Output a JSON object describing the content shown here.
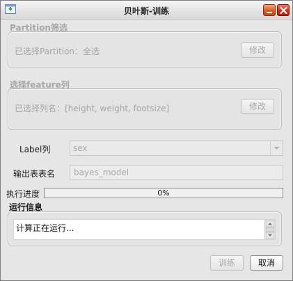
{
  "window": {
    "title": "贝叶斯-训练",
    "app_icon": "window-app-icon",
    "minimize_icon": "minimize-icon",
    "close_icon": "close-icon"
  },
  "partition": {
    "section_title": "Partition筛选",
    "summary": "已选择Partition：全选",
    "edit_label": "修改"
  },
  "features": {
    "section_title": "选择feature列",
    "summary": "已选择列名：[height, weight, footsize]",
    "edit_label": "修改"
  },
  "form": {
    "label_column_label": "Label列",
    "label_column_value": "sex",
    "output_table_label": "输出表表名",
    "output_table_value": "bayes_model"
  },
  "progress": {
    "label": "执行进度",
    "value": 0,
    "text": "0%"
  },
  "log": {
    "section_title": "运行信息",
    "text": "计算正在运行..."
  },
  "footer": {
    "train_label": "训练",
    "cancel_label": "取消"
  },
  "colors": {
    "progress_fill": "#5b86c9",
    "disabled_text": "#a8a8a8",
    "close_red": "#cf2d16",
    "minimize_orange": "#dc5b20"
  }
}
